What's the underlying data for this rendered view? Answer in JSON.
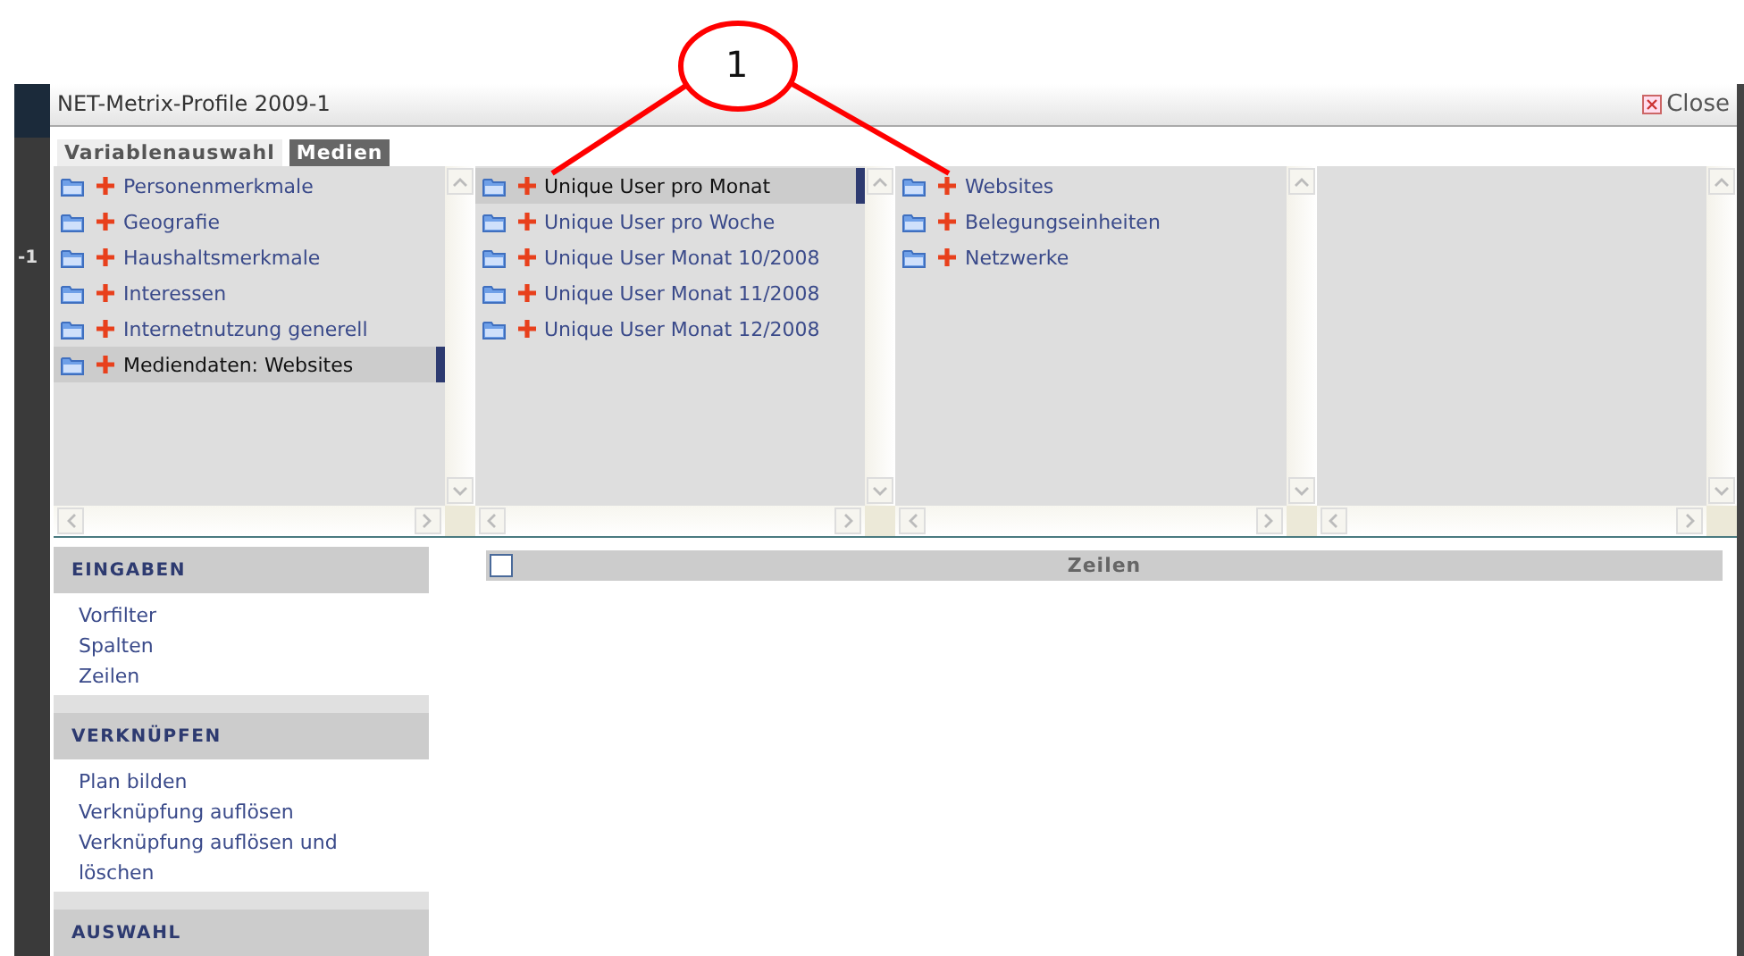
{
  "callout": {
    "label": "1"
  },
  "background_app": {
    "fragment": "-1"
  },
  "window": {
    "title": "NET-Metrix-Profile 2009-1",
    "close": "Close"
  },
  "tabs": [
    {
      "label": "Variablenauswahl",
      "selected": false
    },
    {
      "label": "Medien",
      "selected": true
    }
  ],
  "panes": [
    {
      "items": [
        {
          "label": "Personenmerkmale",
          "selected": false
        },
        {
          "label": "Geografie",
          "selected": false
        },
        {
          "label": "Haushaltsmerkmale",
          "selected": false
        },
        {
          "label": "Interessen",
          "selected": false
        },
        {
          "label": "Internetnutzung generell",
          "selected": false
        },
        {
          "label": "Mediendaten: Websites",
          "selected": true
        }
      ]
    },
    {
      "items": [
        {
          "label": "Unique User pro Monat",
          "selected": true
        },
        {
          "label": "Unique User pro Woche",
          "selected": false
        },
        {
          "label": "Unique User Monat 10/2008",
          "selected": false
        },
        {
          "label": "Unique User Monat 11/2008",
          "selected": false
        },
        {
          "label": "Unique User Monat 12/2008",
          "selected": false
        }
      ]
    },
    {
      "items": [
        {
          "label": "Websites",
          "selected": false
        },
        {
          "label": "Belegungseinheiten",
          "selected": false
        },
        {
          "label": "Netzwerke",
          "selected": false
        }
      ]
    }
  ],
  "sidebar": [
    {
      "heading": "EINGABEN",
      "items": [
        "Vorfilter",
        "Spalten",
        "Zeilen"
      ]
    },
    {
      "heading": "VERKNÜPFEN",
      "items": [
        "Plan bilden",
        "Verknüpfung auflösen",
        "Verknüpfung auflösen und löschen"
      ]
    },
    {
      "heading": "AUSWAHL"
    }
  ],
  "table": {
    "header": "Zeilen",
    "checked": false
  }
}
